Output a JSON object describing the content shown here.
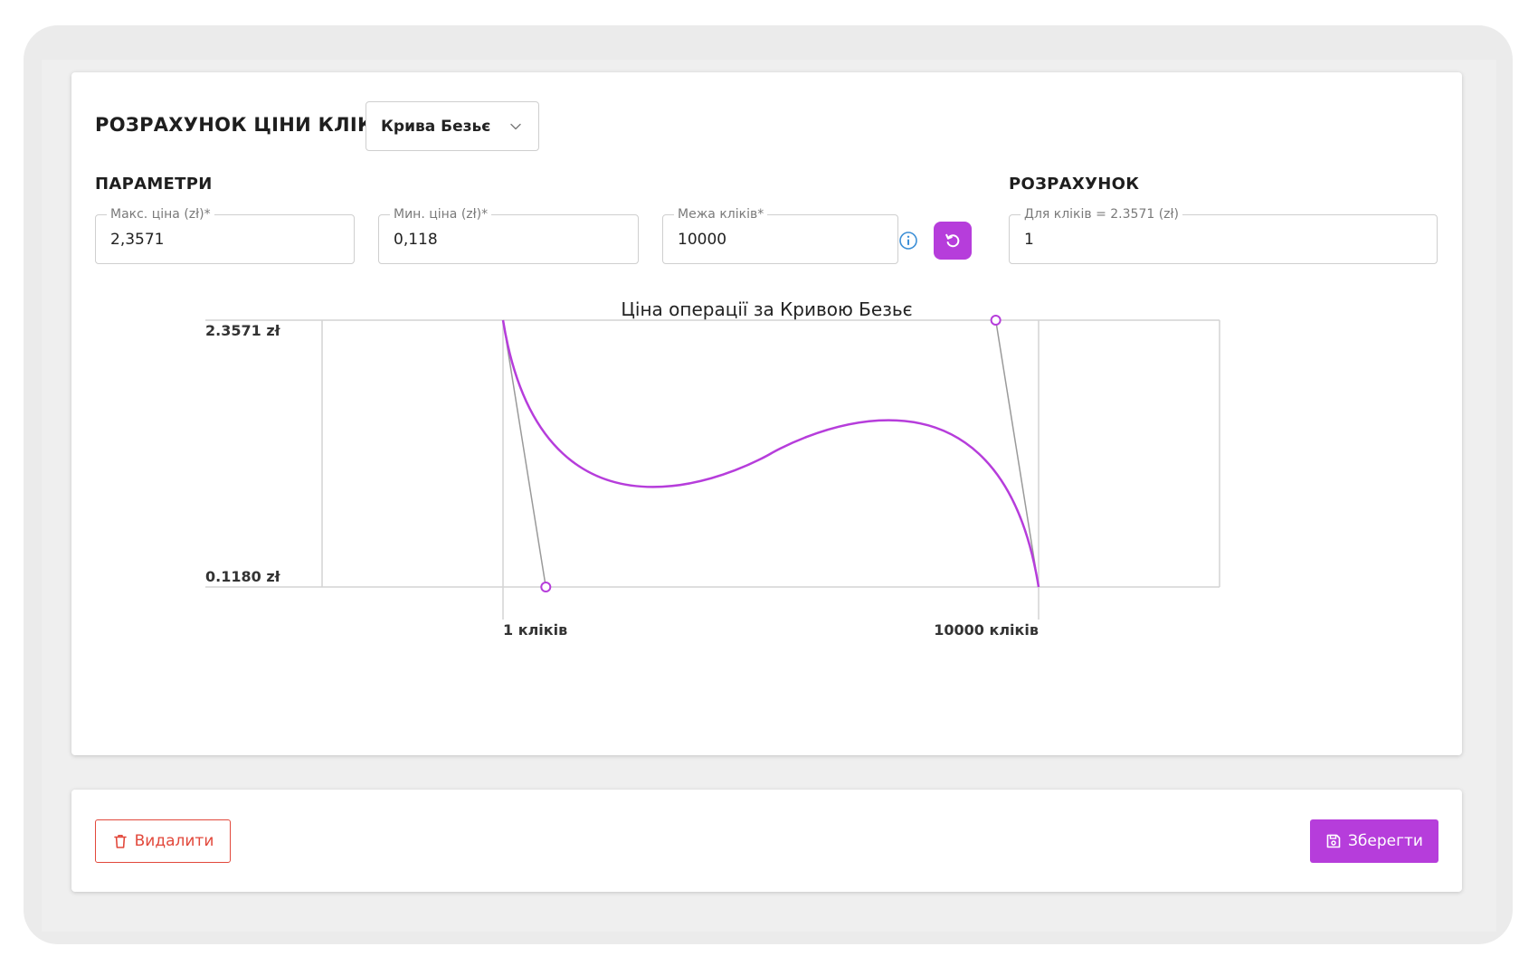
{
  "header": {
    "title": "РОЗРАХУНОК ЦІНИ КЛІКА",
    "method_selected": "Крива Безьє"
  },
  "params": {
    "section_title": "ПАРАМЕТРИ",
    "max_price": {
      "label": "Макс. ціна (zł)*",
      "value": "2,3571"
    },
    "min_price": {
      "label": "Мин. ціна (zł)*",
      "value": "0,118"
    },
    "click_limit": {
      "label": "Межа кліків*",
      "value": "10000"
    }
  },
  "calculation": {
    "section_title": "РОЗРАХУНОК",
    "label": "Для кліків = 2.3571 (zł)",
    "value": "1"
  },
  "chart_data": {
    "type": "line",
    "title": "Ціна операції за Кривою Безьє",
    "y_tick_labels": [
      "2.3571 zł",
      "0.1180 zł"
    ],
    "x_tick_labels": [
      "1 кліків",
      "10000 кліків"
    ],
    "ylim": [
      0.118,
      2.3571
    ],
    "xlim": [
      1,
      10000
    ],
    "curve": "cubic-bezier",
    "segments": [
      {
        "start": {
          "x": 1,
          "y": 2.3571
        },
        "control": {
          "x": 800,
          "y": 0.118
        },
        "end": {
          "x": 5000,
          "y": 1.2375
        }
      },
      {
        "start": {
          "x": 5000,
          "y": 1.2375
        },
        "control": {
          "x": 9200,
          "y": 2.3571
        },
        "end": {
          "x": 10000,
          "y": 0.118
        }
      }
    ],
    "grid": true,
    "colors": {
      "curve": "#b63ddb",
      "handles": "#9a9a9a",
      "grid": "#d4d4d4"
    }
  },
  "actions": {
    "delete_label": "Видалити",
    "save_label": "Зберегти"
  },
  "colors": {
    "accent": "#b63ddb",
    "danger": "#e2483b",
    "info": "#3d8fd6"
  },
  "icons": {
    "select_chevron": "chevron-down-icon",
    "info": "info-icon",
    "reset": "refresh-icon",
    "delete": "trash-icon",
    "save": "floppy-disk-icon"
  }
}
